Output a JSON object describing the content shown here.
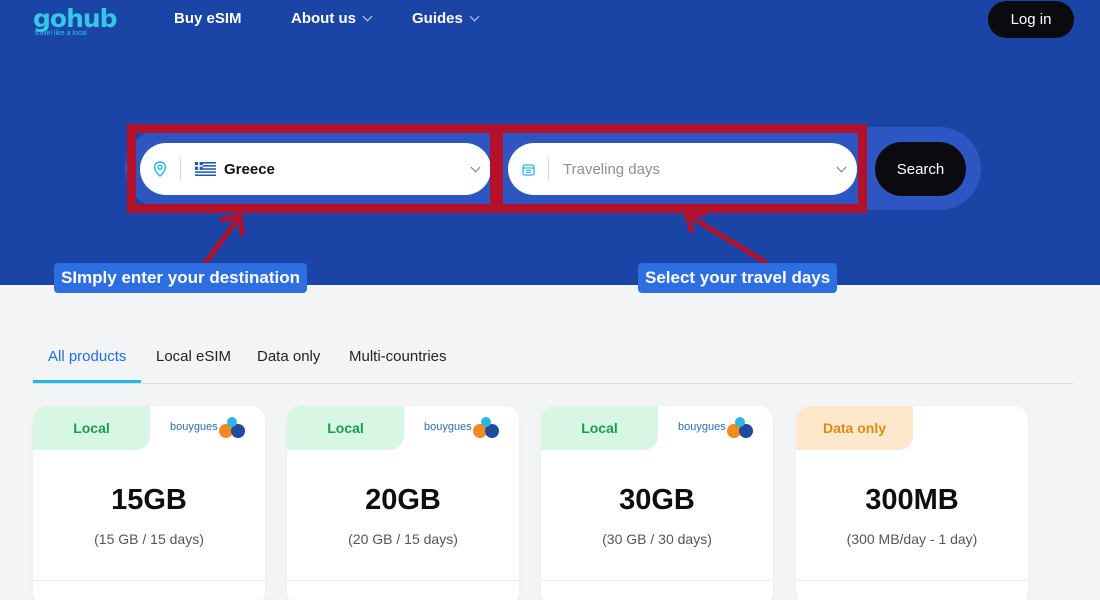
{
  "header": {
    "logo": {
      "name": "gohub",
      "tagline": "travel like a local"
    },
    "nav": [
      {
        "label": "Buy eSIM",
        "has_dropdown": false
      },
      {
        "label": "About us",
        "has_dropdown": true
      },
      {
        "label": "Guides",
        "has_dropdown": true
      }
    ],
    "login_label": "Log in"
  },
  "search": {
    "destination": {
      "value": "Greece",
      "flag": "greece-flag"
    },
    "days": {
      "placeholder": "Traveling days"
    },
    "button_label": "Search"
  },
  "annotations": {
    "destination_callout": "SImply enter your destination",
    "days_callout": "Select your travel days",
    "highlight_color": "#b3102a"
  },
  "tabs": [
    {
      "label": "All products",
      "active": true
    },
    {
      "label": "Local eSIM",
      "active": false
    },
    {
      "label": "Data only",
      "active": false
    },
    {
      "label": "Multi-countries",
      "active": false
    }
  ],
  "products": [
    {
      "badge": "Local",
      "badge_type": "local",
      "brand": "bouygues",
      "amount": "15GB",
      "detail": "(15 GB / 15 days)"
    },
    {
      "badge": "Local",
      "badge_type": "local",
      "brand": "bouygues",
      "amount": "20GB",
      "detail": "(20 GB / 15 days)"
    },
    {
      "badge": "Local",
      "badge_type": "local",
      "brand": "bouygues",
      "amount": "30GB",
      "detail": "(30 GB / 30 days)"
    },
    {
      "badge": "Data only",
      "badge_type": "data",
      "brand": "",
      "amount": "300MB",
      "detail": "(300 MB/day - 1 day)"
    }
  ],
  "colors": {
    "hero_bg": "#1a44a6",
    "accent_blue": "#1f6ee0",
    "callout_bg": "#2d6fe0",
    "local_green": "#1e9b4a",
    "data_orange": "#e08a12"
  }
}
